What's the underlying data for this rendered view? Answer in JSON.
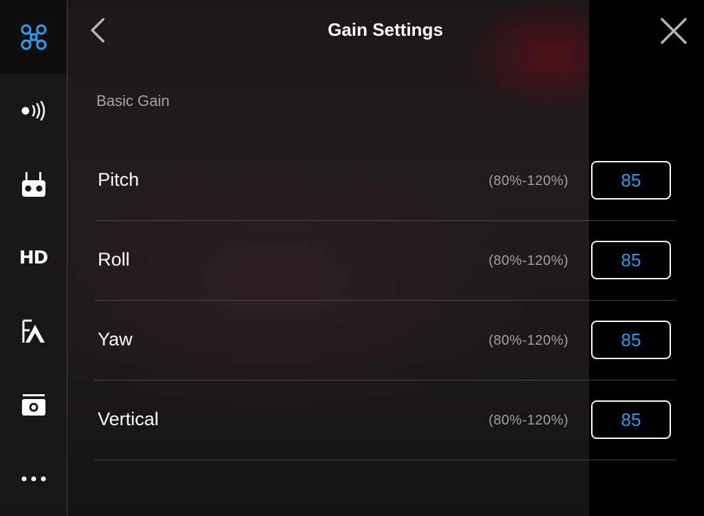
{
  "header": {
    "title": "Gain Settings"
  },
  "sidebar": {
    "items": [
      {
        "icon": "drone-icon",
        "active": true
      },
      {
        "icon": "signal-icon"
      },
      {
        "icon": "remote-controller-icon"
      },
      {
        "icon": "hd-icon",
        "label": "HD"
      },
      {
        "icon": "flight-instruction-icon"
      },
      {
        "icon": "camera-icon"
      },
      {
        "icon": "more-icon"
      }
    ]
  },
  "section": {
    "label": "Basic Gain"
  },
  "gains": [
    {
      "label": "Pitch",
      "range": "(80%-120%)",
      "value": "85"
    },
    {
      "label": "Roll",
      "range": "(80%-120%)",
      "value": "85"
    },
    {
      "label": "Yaw",
      "range": "(80%-120%)",
      "value": "85"
    },
    {
      "label": "Vertical",
      "range": "(80%-120%)",
      "value": "85"
    }
  ],
  "colors": {
    "accent": "#2f9ae8",
    "text": "#ffffff",
    "secondary_text": "#a3a0a2"
  }
}
